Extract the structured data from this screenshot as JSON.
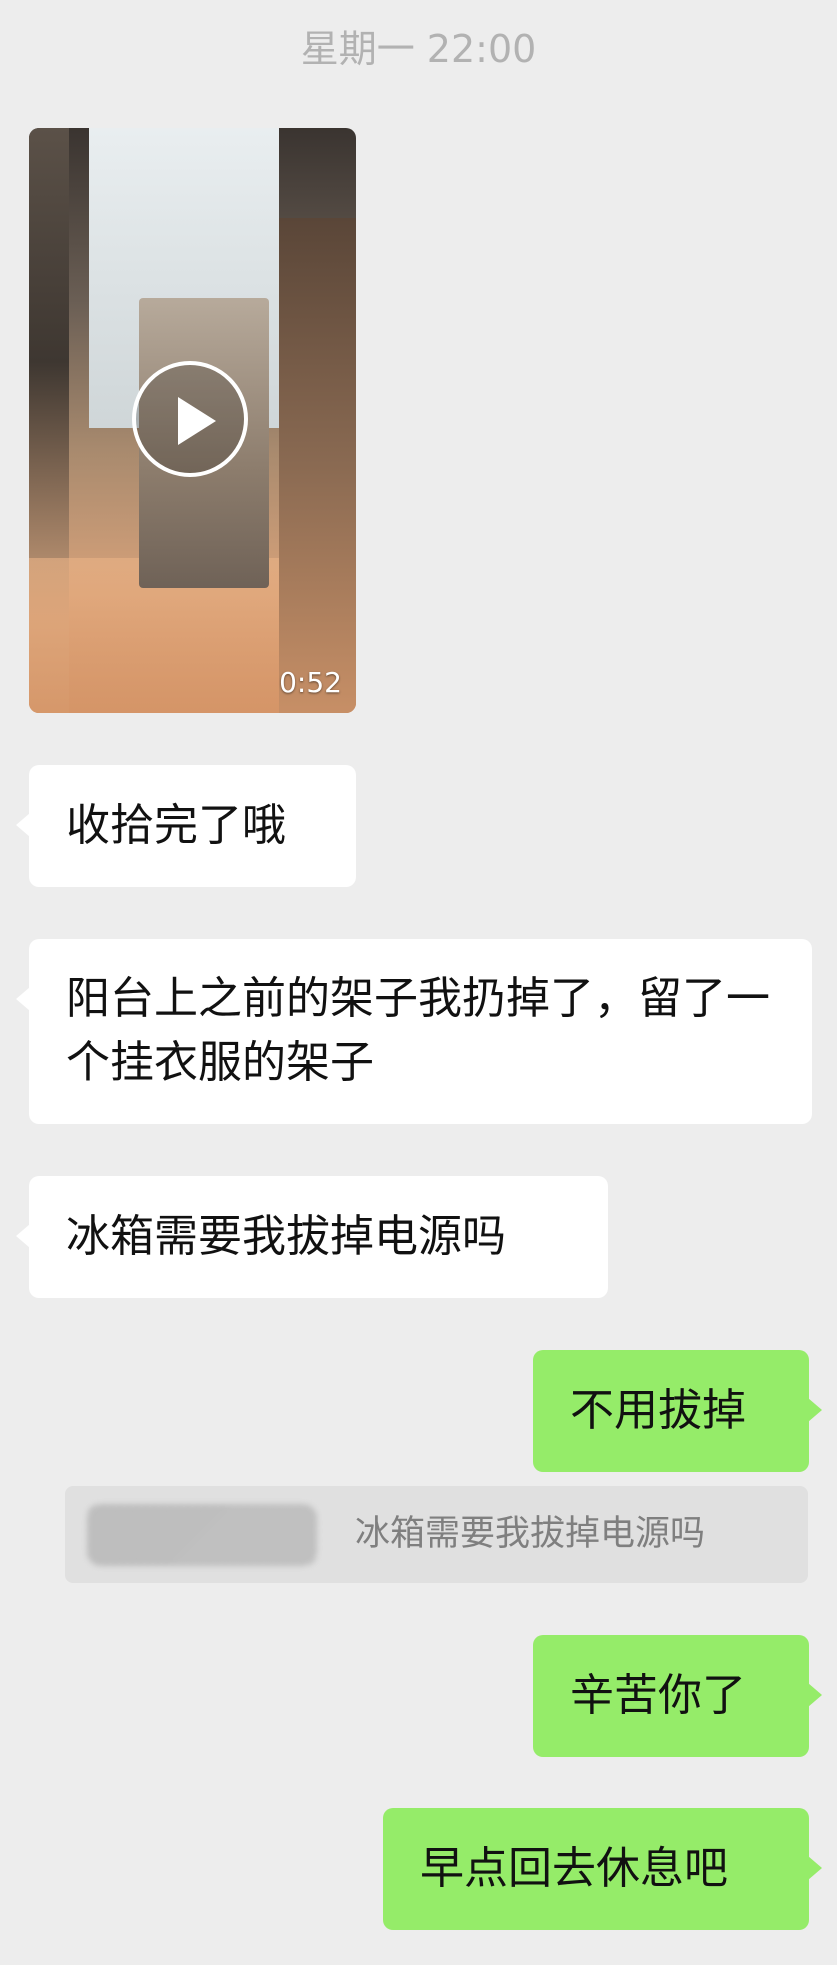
{
  "header": {
    "timestamp": "星期一 22:00"
  },
  "video": {
    "duration": "0:52"
  },
  "messages": [
    {
      "text": "收拾完了哦"
    },
    {
      "text": "阳台上之前的架子我扔掉了，留了一个挂衣服的架子"
    },
    {
      "text": "冰箱需要我拔掉电源吗"
    },
    {
      "text": "不用拔掉"
    },
    {
      "text": "辛苦你了"
    },
    {
      "text": "早点回去休息吧"
    }
  ],
  "quote": {
    "text": "冰箱需要我拔掉电源吗"
  },
  "colors": {
    "background": "#ededed",
    "incoming_bubble": "#ffffff",
    "outgoing_bubble": "#95ec69",
    "timestamp": "#b2b2b2"
  }
}
